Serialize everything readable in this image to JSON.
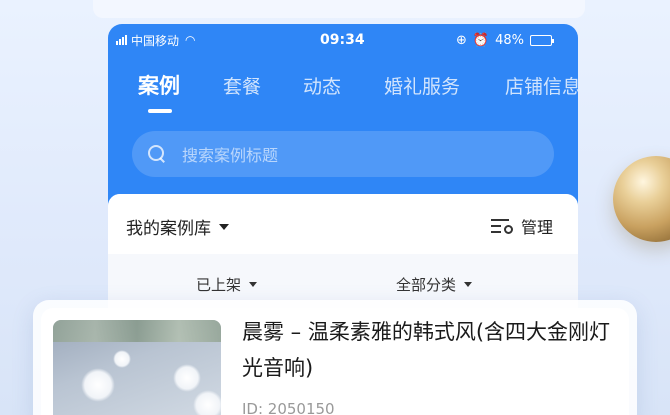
{
  "status_bar": {
    "carrier": "中国移动",
    "time": "09:34",
    "battery": "48%"
  },
  "tabs": [
    {
      "label": "案例",
      "active": true
    },
    {
      "label": "套餐",
      "active": false
    },
    {
      "label": "动态",
      "active": false
    },
    {
      "label": "婚礼服务",
      "active": false
    },
    {
      "label": "店铺信息",
      "active": false
    }
  ],
  "search": {
    "placeholder": "搜索案例标题",
    "icon": "search-icon"
  },
  "library": {
    "title": "我的案例库",
    "manage_label": "管理"
  },
  "filters": {
    "status_label": "已上架",
    "category_label": "全部分类"
  },
  "card": {
    "title": "晨雾 – 温柔素雅的韩式风(含四大金刚灯光音响)",
    "id_text": "ID: 2050150"
  },
  "colors": {
    "primary": "#2f86f6",
    "background": "#eaf2ff"
  }
}
